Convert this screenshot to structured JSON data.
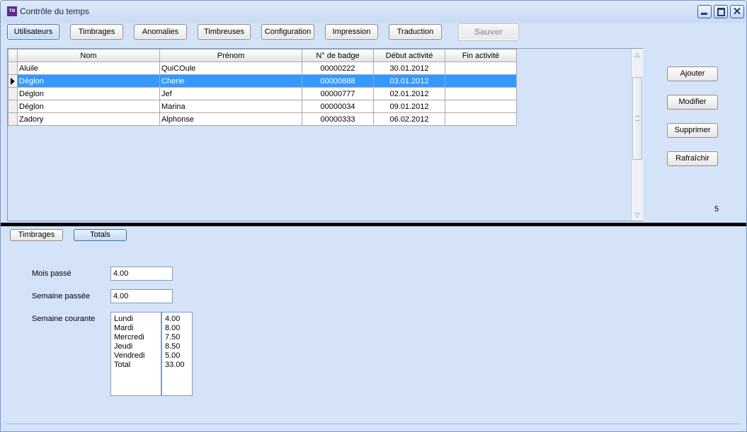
{
  "window": {
    "title": "Contrôle du temps",
    "app_icon_text": "TM"
  },
  "toolbar": {
    "tabs": [
      {
        "label": "Utilisateurs",
        "active": true
      },
      {
        "label": "Timbrages"
      },
      {
        "label": "Anomalies"
      },
      {
        "label": "Timbreuses"
      },
      {
        "label": "Configuration"
      },
      {
        "label": "Impression"
      },
      {
        "label": "Traduction"
      }
    ],
    "save_label": "Sauver"
  },
  "users_table": {
    "columns": [
      "Nom",
      "Prénom",
      "N° de badge",
      "Début activité",
      "Fin activité"
    ],
    "rows": [
      {
        "nom": "Aluile",
        "prenom": "QuiCOule",
        "badge": "00000222",
        "debut": "30.01.2012",
        "fin": ""
      },
      {
        "nom": "Déglon",
        "prenom": "Cherie",
        "badge": "00000888",
        "debut": "03.01.2012",
        "fin": "",
        "selected": true
      },
      {
        "nom": "Déglon",
        "prenom": "Jef",
        "badge": "00000777",
        "debut": "02.01.2012",
        "fin": ""
      },
      {
        "nom": "Déglon",
        "prenom": "Marina",
        "badge": "00000034",
        "debut": "09.01.2012",
        "fin": ""
      },
      {
        "nom": "Zadory",
        "prenom": "Alphonse",
        "badge": "00000333",
        "debut": "06.02.2012",
        "fin": ""
      }
    ]
  },
  "side_actions": {
    "add": "Ajouter",
    "edit": "Modifier",
    "delete": "Supprimer",
    "refresh": "Rafraîchir"
  },
  "record_count": "5",
  "subtabs": [
    {
      "label": "Timbrages"
    },
    {
      "label": "Totals",
      "active": true
    }
  ],
  "totals": {
    "last_month_label": "Mois passé",
    "last_month_value": "4.00",
    "last_week_label": "Semaine passée",
    "last_week_value": "4.00",
    "current_week_label": "Semaine courante",
    "days": [
      "Lundi",
      "Mardi",
      "Mercredi",
      "Jeudi",
      "Vendredi",
      "Total"
    ],
    "hours": [
      "4.00",
      "8.00",
      "7.50",
      "8.50",
      "5.00",
      "33.00"
    ]
  }
}
